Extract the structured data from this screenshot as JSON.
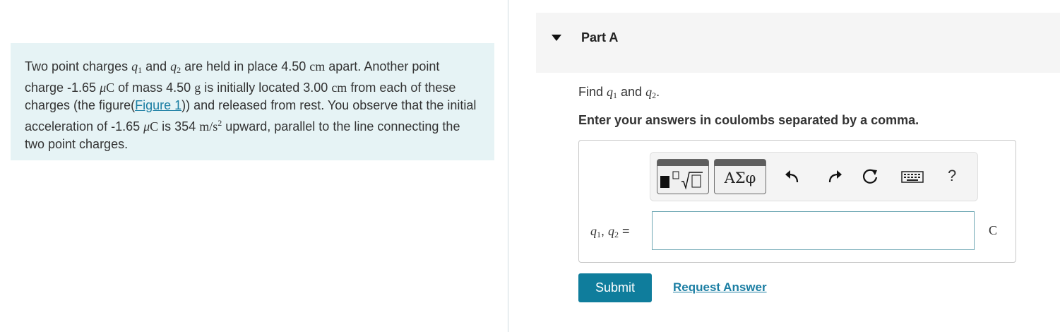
{
  "problem": {
    "t1": "Two point charges ",
    "q1": "q",
    "q1_sub": "1",
    "t2": " and ",
    "q2": "q",
    "q2_sub": "2",
    "t3": " are held in place 4.50 ",
    "u_cm1": "cm",
    "t4": " apart. Another point charge -1.65 ",
    "u_mu1": "μ",
    "u_C1": "C",
    "t5": " of mass 4.50 ",
    "u_g": "g",
    "t6": " is initially located 3.00 ",
    "u_cm2": "cm",
    "t7": " from each of these charges (the figure(",
    "figure_link": "Figure 1",
    "t8": ")) and released from rest. You observe that the initial acceleration of -1.65 ",
    "u_mu2": "μ",
    "u_C2": "C",
    "t9": " is 354 ",
    "u_ms": "m/s",
    "u_sq": "2",
    "t10": " upward, parallel to the line connecting the two point charges."
  },
  "part": {
    "title": "Part A",
    "find_prefix": "Find ",
    "find_and": " and ",
    "find_suffix": ".",
    "var_q": "q",
    "sub1": "1",
    "sub2": "2",
    "instruction": "Enter your answers in coulombs separated by a comma."
  },
  "toolbar": {
    "greek_label": "ΑΣφ",
    "help_label": "?",
    "icons": [
      "templates-icon",
      "greek-letters-icon",
      "undo-icon",
      "redo-icon",
      "reset-icon",
      "keyboard-icon",
      "help-icon"
    ]
  },
  "answer": {
    "label_sep": ", ",
    "label_eq": " =",
    "value": "",
    "unit": "C"
  },
  "actions": {
    "submit_label": "Submit",
    "request_label": "Request Answer"
  },
  "colors": {
    "problem_bg": "#e6f3f5",
    "link": "#1b7ea3",
    "submit_bg": "#0f7d9c",
    "input_border": "#6fa8b4"
  }
}
